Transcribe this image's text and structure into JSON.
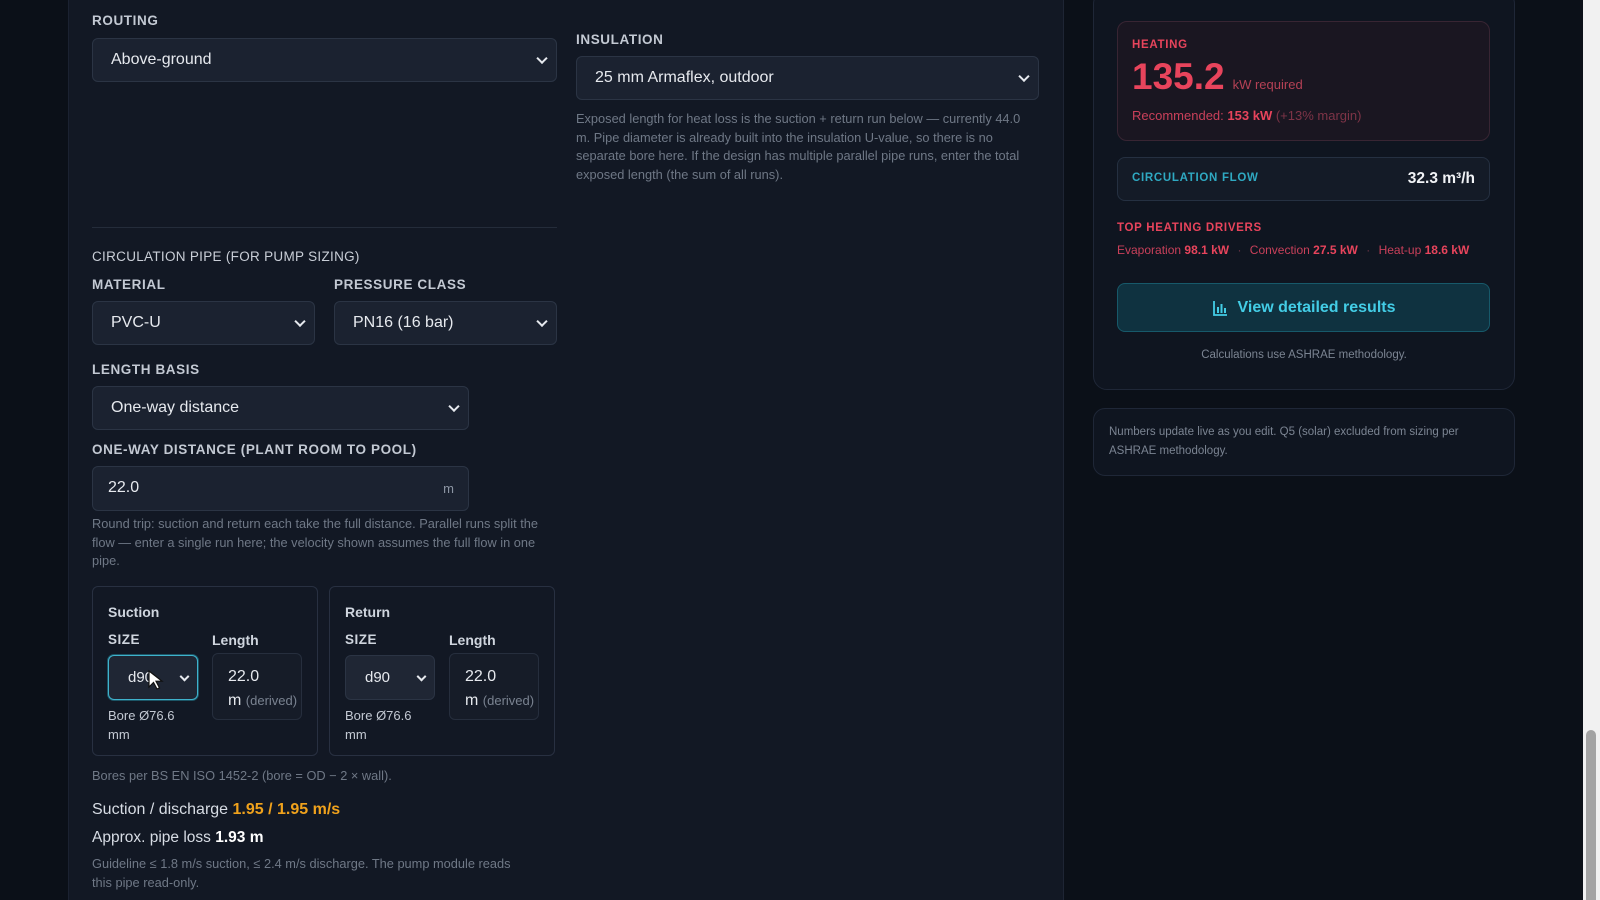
{
  "routing": {
    "label": "ROUTING",
    "selected": "Above-ground"
  },
  "insulation": {
    "label": "INSULATION",
    "selected": "25 mm Armaflex, outdoor",
    "help": "Exposed length for heat loss is the suction + return run below — currently 44.0 m. Pipe diameter is already built into the insulation U-value, so there is no separate bore here. If the design has multiple parallel pipe runs, enter the total exposed length (the sum of all runs)."
  },
  "circ_pipe": {
    "heading": "CIRCULATION PIPE (FOR PUMP SIZING)",
    "material_label": "MATERIAL",
    "material": "PVC-U",
    "pressure_label": "PRESSURE CLASS",
    "pressure": "PN16 (16 bar)",
    "length_basis_label": "LENGTH BASIS",
    "length_basis": "One-way distance",
    "distance_label": "ONE-WAY DISTANCE (PLANT ROOM TO POOL)",
    "distance_value": "22.0",
    "distance_unit": "m",
    "distance_help": "Round trip: suction and return each take the full distance. Parallel runs split the flow — enter a single run here; the velocity shown assumes the full flow in one pipe."
  },
  "suction": {
    "title": "Suction",
    "size_label": "SIZE",
    "size": "d90",
    "length_label": "Length",
    "length": "22.0",
    "length_unit": "m",
    "derived": "(derived)",
    "bore": "Bore Ø76.6 mm"
  },
  "return": {
    "title": "Return",
    "size_label": "SIZE",
    "size": "d90",
    "length_label": "Length",
    "length": "22.0",
    "length_unit": "m",
    "derived": "(derived)",
    "bore": "Bore Ø76.6 mm"
  },
  "bores_note": "Bores per BS EN ISO 1452-2 (bore = OD − 2 × wall).",
  "velocity": {
    "label": "Suction / discharge",
    "value": "1.95 / 1.95 m/s"
  },
  "pipe_loss": {
    "label": "Approx. pipe loss",
    "value": "1.93 m"
  },
  "guideline": "Guideline ≤ 1.8 m/s suction, ≤ 2.4 m/s discharge. The pump module reads this pipe read-only.",
  "summary": {
    "heating_label": "HEATING",
    "heating_value": "135.2",
    "heating_unit": "kW required",
    "recommended_label": "Recommended:",
    "recommended_value": "153 kW",
    "recommended_margin": "(+13% margin)",
    "flow_label": "CIRCULATION FLOW",
    "flow_value": "32.3 m³/h",
    "drivers_label": "TOP HEATING DRIVERS",
    "drivers": [
      {
        "name": "Evaporation",
        "value": "98.1 kW"
      },
      {
        "name": "Convection",
        "value": "27.5 kW"
      },
      {
        "name": "Heat-up",
        "value": "18.6 kW"
      }
    ],
    "separator": "·",
    "results_button": "View detailed results",
    "methodology": "Calculations use ASHRAE methodology."
  },
  "live_note": "Numbers update live as you edit. Q5 (solar) excluded from sizing per ASHRAE methodology.",
  "colors": {
    "accent_red": "#e8445c",
    "accent_cyan": "#43cde6",
    "accent_orange": "#f0a21c"
  }
}
